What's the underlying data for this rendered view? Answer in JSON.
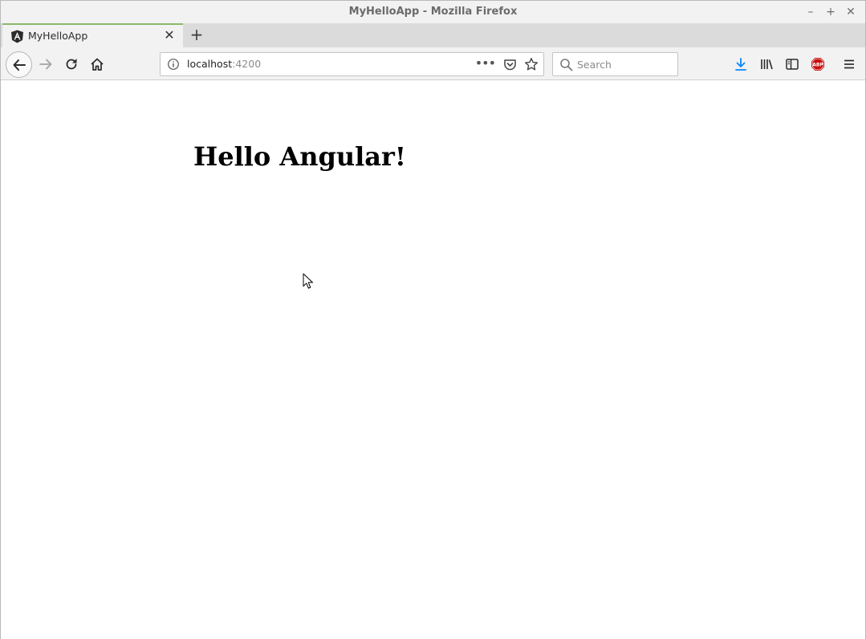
{
  "window": {
    "title": "MyHelloApp - Mozilla Firefox"
  },
  "window_controls": {
    "minimize": "–",
    "maximize": "+",
    "close": "✕"
  },
  "tabs": [
    {
      "label": "MyHelloApp",
      "favicon": "angular-icon",
      "active": true
    }
  ],
  "new_tab_label": "+",
  "toolbar": {
    "url_host": "localhost",
    "url_port": ":4200",
    "page_actions_label": "•••",
    "search_placeholder": "Search"
  },
  "page": {
    "heading": "Hello Angular!"
  },
  "colors": {
    "tab_accent": "#8cb86b",
    "download_icon": "#0a84ff",
    "abp_icon": "#c70d0d"
  }
}
